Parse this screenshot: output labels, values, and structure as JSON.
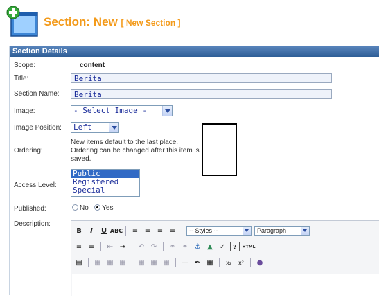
{
  "header": {
    "title": "Section:",
    "mode": "New",
    "subtitle": "[ New Section ]"
  },
  "panel": {
    "title": "Section Details"
  },
  "form": {
    "scope_label": "Scope:",
    "scope_value": "content",
    "title_label": "Title:",
    "title_value": "Berita",
    "section_name_label": "Section Name:",
    "section_name_value": "Berita",
    "image_label": "Image:",
    "image_value": "- Select Image -",
    "image_position_label": "Image Position:",
    "image_position_value": "Left",
    "ordering_label": "Ordering:",
    "ordering_note": "New items default to the last place. Ordering can be changed after this item is saved.",
    "access_level_label": "Access Level:",
    "access_options": [
      "Public",
      "Registered",
      "Special"
    ],
    "access_selected": "Public",
    "published_label": "Published:",
    "published_no": "No",
    "published_yes": "Yes",
    "published_value": "Yes",
    "description_label": "Description:"
  },
  "editor": {
    "styles_value": "-- Styles --",
    "format_value": "Paragraph",
    "html_label": "HTML"
  }
}
